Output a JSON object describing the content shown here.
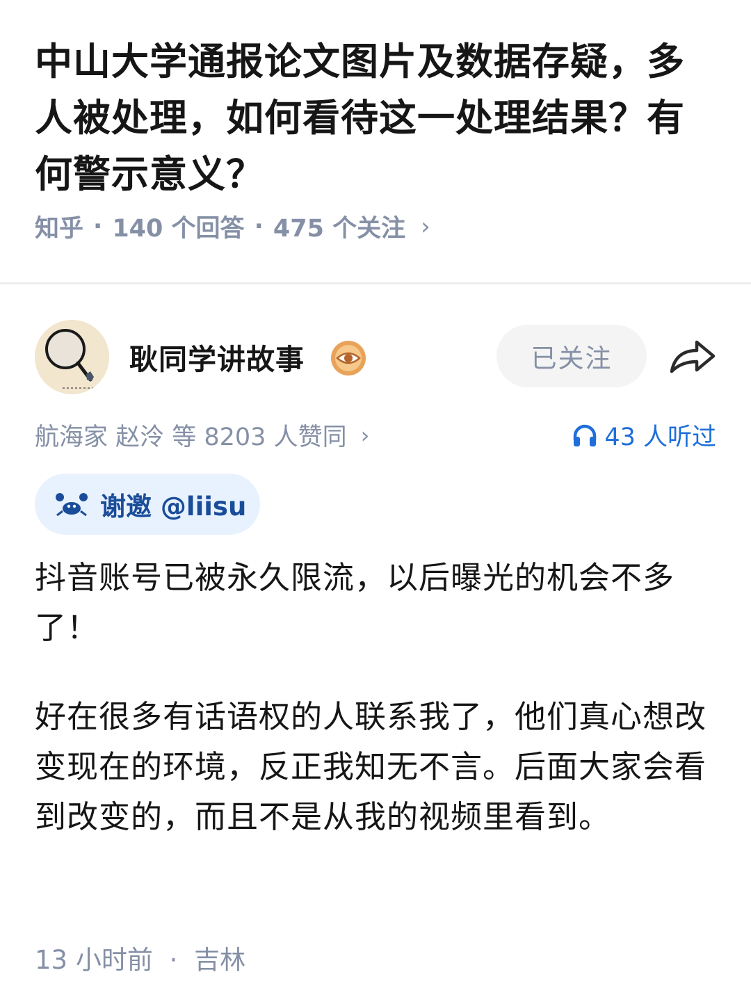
{
  "question": {
    "title": "中山大学通报论文图片及数据存疑，多人被处理，如何看待这一处理结果？有何警示意义？",
    "source": "知乎",
    "answers": "140 个回答",
    "follows": "475 个关注",
    "sep": "·",
    "chevron": "›"
  },
  "author": {
    "name": "耿同学讲故事",
    "follow_label": "已关注",
    "avatar_icon": "magnifier-avatar-icon",
    "badge_icon": "eye-badge-icon",
    "share_icon": "share-arrow-icon"
  },
  "stats": {
    "upvotes_text": "航海家 赵泠 等 8203 人赞同",
    "chevron": "›",
    "listens_text": "43 人听过",
    "accent": "#1e6fd9"
  },
  "thanks": {
    "label": "谢邀 @liisu"
  },
  "answer": {
    "paragraphs": [
      "抖音账号已被永久限流，以后曝光的机会不多了！",
      "好在很多有话语权的人联系我了，他们真心想改变现在的环境，反正我知无不言。后面大家会看到改变的，而且不是从我的视频里看到。"
    ]
  },
  "footer": {
    "time": "13 小时前",
    "sep": "·",
    "location": "吉林"
  }
}
